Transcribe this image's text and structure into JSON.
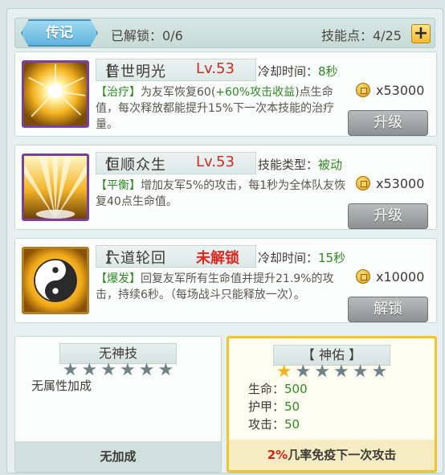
{
  "header": {
    "tab_label": "传记",
    "unlocked_label": "已解锁：0/6",
    "skill_points_label": "技能点：4/25",
    "plus_label": "+"
  },
  "skills": [
    {
      "name": "普世明光",
      "level": "Lv.53",
      "stat_label": "冷却时间：",
      "stat_value": "8秒",
      "desc_tag": "【治疗】",
      "desc_pre": "为友军恢复60(",
      "desc_hi": "+60%攻击收益",
      "desc_post": ")点生命值，每次释放都能提升15%下一次本技能的治疗量。",
      "cost": "x53000",
      "button": "升级"
    },
    {
      "name": "恒顺众生",
      "level": "Lv.53",
      "stat_label": "技能类型：",
      "stat_value": "被动",
      "desc_tag": "【平衡】",
      "desc_pre": "增加友军5%的攻击，每1秒为全体队友恢复40点生命值。",
      "desc_hi": "",
      "desc_post": "",
      "cost": "x53000",
      "button": "升级"
    },
    {
      "name": "六道轮回",
      "level": "未解锁",
      "stat_label": "冷却时间：",
      "stat_value": "15秒",
      "desc_tag": "【爆发】",
      "desc_pre": "回复友军所有生命值并提升21.9%的攻击，持续6秒。（每场战斗只能释放一次）。",
      "desc_hi": "",
      "desc_post": "",
      "cost": "x10000",
      "button": "解锁"
    }
  ],
  "panels": {
    "left": {
      "title": "无神技",
      "stars_on": 0,
      "stars_total": 6,
      "note": "无属性加成",
      "footer": "无加成"
    },
    "right": {
      "title": "【 神佑 】",
      "stars_on": 1,
      "stars_total": 6,
      "stats": [
        {
          "label": "生命：",
          "value": "500"
        },
        {
          "label": "护甲：",
          "value": "50"
        },
        {
          "label": "攻击：",
          "value": "50"
        }
      ],
      "footer_hi": "2%",
      "footer_text": "几率免疫下一次攻击"
    }
  },
  "icons": {
    "tab_decoration": "ornament-icon",
    "coin": "gold-coin-icon",
    "star": "star-icon",
    "skill_1": "radiant-light-icon",
    "skill_2": "golden-rays-icon",
    "skill_3": "yin-yang-icon"
  },
  "colors": {
    "accent_red": "#d22a1e",
    "accent_green": "#2f8a23",
    "selected_gold": "#f1c430",
    "star_gold": "#f4b21b"
  }
}
